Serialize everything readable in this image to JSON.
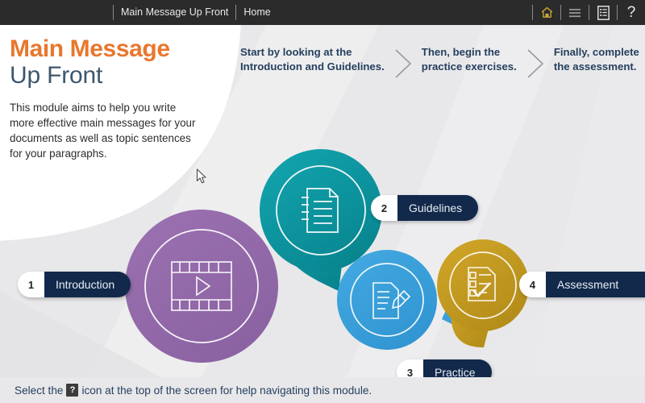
{
  "topbar": {
    "module_title": "Main Message Up Front",
    "home_label": "Home",
    "icons": [
      {
        "name": "home-icon",
        "glyph": "home",
        "color": "#d2a63c"
      },
      {
        "name": "menu-icon",
        "glyph": "menu",
        "color": "#9a9a9a"
      },
      {
        "name": "notes-icon",
        "glyph": "notes",
        "color": "#e9e9e9"
      },
      {
        "name": "help-icon",
        "glyph": "?",
        "color": "#e9e9e9"
      }
    ]
  },
  "title": {
    "line1": "Main Message",
    "line2": "Up Front",
    "line1_color": "#e8772e",
    "line2_color": "#3d566e",
    "description": "This module aims to help you write more effective main messages for your documents as well as topic sentences for your paragraphs."
  },
  "steps": [
    {
      "text": "Start by looking at the\nIntroduction and Guidelines."
    },
    {
      "text": "Then, begin the\npractice exercises."
    },
    {
      "text": "Finally, complete\nthe assessment."
    }
  ],
  "nodes": [
    {
      "number": "1",
      "label": "Introduction",
      "color": "#9268a8",
      "icon": "film-play-icon"
    },
    {
      "number": "2",
      "label": "Guidelines",
      "color": "#0e9aa4",
      "icon": "document-list-icon"
    },
    {
      "number": "3",
      "label": "Practice",
      "color": "#3ba0dc",
      "icon": "document-pencil-icon"
    },
    {
      "number": "4",
      "label": "Assessment",
      "color": "#c39a21",
      "icon": "checklist-check-icon"
    }
  ],
  "footer": {
    "text_before": "Select the",
    "icon_glyph": "?",
    "text_after": "icon at the top of the screen for help navigating this module."
  },
  "theme": {
    "background": "#e8e8ea",
    "topbar_background": "#2b2b2b",
    "pill_label_background": "#12294b",
    "pill_number_background": "#ffffff",
    "footer_text_color": "#26405f"
  }
}
